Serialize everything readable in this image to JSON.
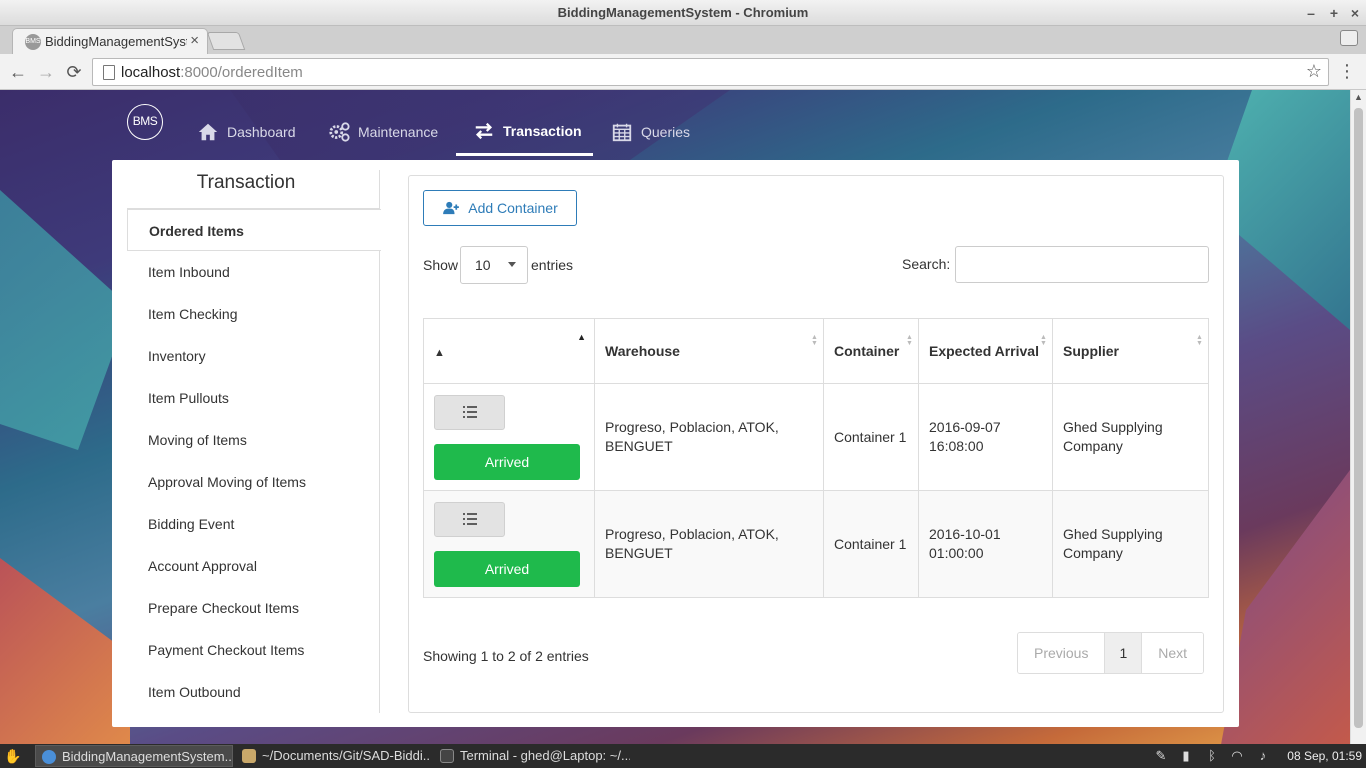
{
  "window": {
    "title": "BiddingManagementSystem - Chromium",
    "minimize": "–",
    "maximize": "+",
    "close": "×"
  },
  "browser": {
    "tab_title": "BiddingManagementSystem",
    "tab_close": "×",
    "url_host": "localhost",
    "url_path": ":8000/orderedItem",
    "back": "←",
    "forward": "→",
    "reload": "⟳",
    "star": "☆",
    "menu": "⋮"
  },
  "navbar": {
    "logo": "BMS",
    "links": [
      {
        "label": "Dashboard",
        "icon": "home-icon"
      },
      {
        "label": "Maintenance",
        "icon": "gears-icon"
      },
      {
        "label": "Transaction",
        "icon": "exchange-icon",
        "active": true
      },
      {
        "label": "Queries",
        "icon": "calendar-icon"
      }
    ]
  },
  "sidebar": {
    "title": "Transaction",
    "items": [
      {
        "label": "Ordered Items",
        "active": true
      },
      {
        "label": "Item Inbound"
      },
      {
        "label": "Item Checking"
      },
      {
        "label": "Inventory"
      },
      {
        "label": "Item Pullouts"
      },
      {
        "label": "Moving of Items"
      },
      {
        "label": "Approval Moving of Items"
      },
      {
        "label": "Bidding Event"
      },
      {
        "label": "Account Approval"
      },
      {
        "label": "Prepare Checkout Items"
      },
      {
        "label": "Payment Checkout Items"
      },
      {
        "label": "Item Outbound"
      }
    ]
  },
  "content": {
    "add_button": "Add Container",
    "show_label": "Show",
    "length_value": "10",
    "entries_label": "entries",
    "search_label": "Search:",
    "search_value": "",
    "columns": [
      "",
      "Warehouse",
      "Container",
      "Expected Arrival",
      "Supplier"
    ],
    "sort_indicator": "▲",
    "rows": [
      {
        "status": "Arrived",
        "warehouse": "Progreso, Poblacion, ATOK, BENGUET",
        "container": "Container 1",
        "arrival": "2016-09-07 16:08:00",
        "supplier": "Ghed Supplying Company"
      },
      {
        "status": "Arrived",
        "warehouse": "Progreso, Poblacion, ATOK, BENGUET",
        "container": "Container 1",
        "arrival": "2016-10-01 01:00:00",
        "supplier": "Ghed Supplying Company"
      }
    ],
    "info": "Showing 1 to 2 of 2 entries",
    "pager": {
      "previous": "Previous",
      "current": "1",
      "next": "Next"
    }
  },
  "taskbar": {
    "tasks": [
      "BiddingManagementSystem...",
      "~/Documents/Git/SAD-Biddi...",
      "Terminal - ghed@Laptop: ~/..."
    ],
    "clock": "08 Sep, 01:59"
  },
  "colors": {
    "accent_blue": "#2e7cb8",
    "arrived_green": "#1fba4c"
  }
}
